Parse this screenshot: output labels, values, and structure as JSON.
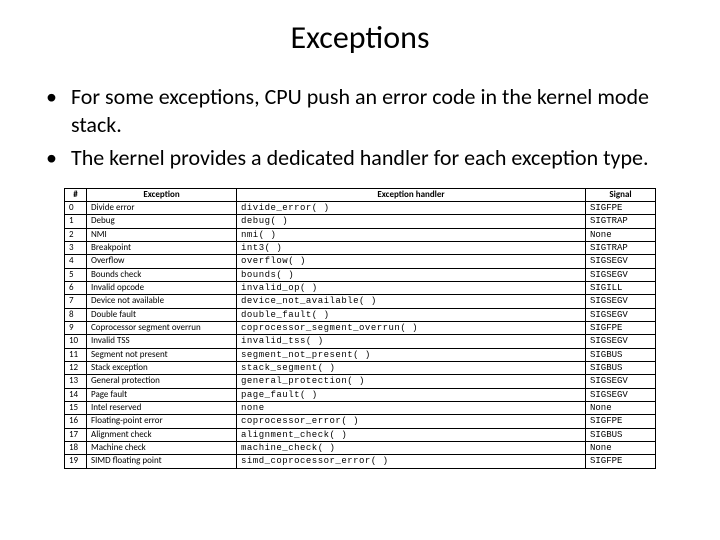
{
  "title": "Exceptions",
  "bullets": [
    "For some exceptions, CPU push an error code in the kernel mode stack.",
    "The kernel provides a dedicated handler for each exception type."
  ],
  "table": {
    "headers": {
      "num": "#",
      "exc": "Exception",
      "handler": "Exception handler",
      "sig": "Signal"
    },
    "rows": [
      {
        "num": "0",
        "exc": "Divide error",
        "handler": "divide_error( )",
        "sig": "SIGFPE"
      },
      {
        "num": "1",
        "exc": "Debug",
        "handler": "debug( )",
        "sig": "SIGTRAP"
      },
      {
        "num": "2",
        "exc": "NMI",
        "handler": "nmi( )",
        "sig": "None"
      },
      {
        "num": "3",
        "exc": "Breakpoint",
        "handler": "int3( )",
        "sig": "SIGTRAP"
      },
      {
        "num": "4",
        "exc": "Overflow",
        "handler": "overflow( )",
        "sig": "SIGSEGV"
      },
      {
        "num": "5",
        "exc": "Bounds check",
        "handler": "bounds( )",
        "sig": "SIGSEGV"
      },
      {
        "num": "6",
        "exc": "Invalid opcode",
        "handler": "invalid_op( )",
        "sig": "SIGILL"
      },
      {
        "num": "7",
        "exc": "Device not available",
        "handler": "device_not_available( )",
        "sig": "SIGSEGV"
      },
      {
        "num": "8",
        "exc": "Double fault",
        "handler": "double_fault( )",
        "sig": "SIGSEGV"
      },
      {
        "num": "9",
        "exc": "Coprocessor segment overrun",
        "handler": "coprocessor_segment_overrun( )",
        "sig": "SIGFPE"
      },
      {
        "num": "10",
        "exc": "Invalid TSS",
        "handler": "invalid_tss( )",
        "sig": "SIGSEGV"
      },
      {
        "num": "11",
        "exc": "Segment not present",
        "handler": "segment_not_present( )",
        "sig": "SIGBUS"
      },
      {
        "num": "12",
        "exc": "Stack exception",
        "handler": "stack_segment( )",
        "sig": "SIGBUS"
      },
      {
        "num": "13",
        "exc": "General protection",
        "handler": "general_protection( )",
        "sig": "SIGSEGV"
      },
      {
        "num": "14",
        "exc": "Page fault",
        "handler": "page_fault( )",
        "sig": "SIGSEGV"
      },
      {
        "num": "15",
        "exc": "Intel reserved",
        "handler": "none",
        "sig": "None"
      },
      {
        "num": "16",
        "exc": "Floating-point error",
        "handler": "coprocessor_error( )",
        "sig": "SIGFPE"
      },
      {
        "num": "17",
        "exc": "Alignment check",
        "handler": "alignment_check( )",
        "sig": "SIGBUS"
      },
      {
        "num": "18",
        "exc": "Machine check",
        "handler": "machine_check( )",
        "sig": "None"
      },
      {
        "num": "19",
        "exc": "SIMD floating point",
        "handler": "simd_coprocessor_error( )",
        "sig": "SIGFPE"
      }
    ]
  }
}
